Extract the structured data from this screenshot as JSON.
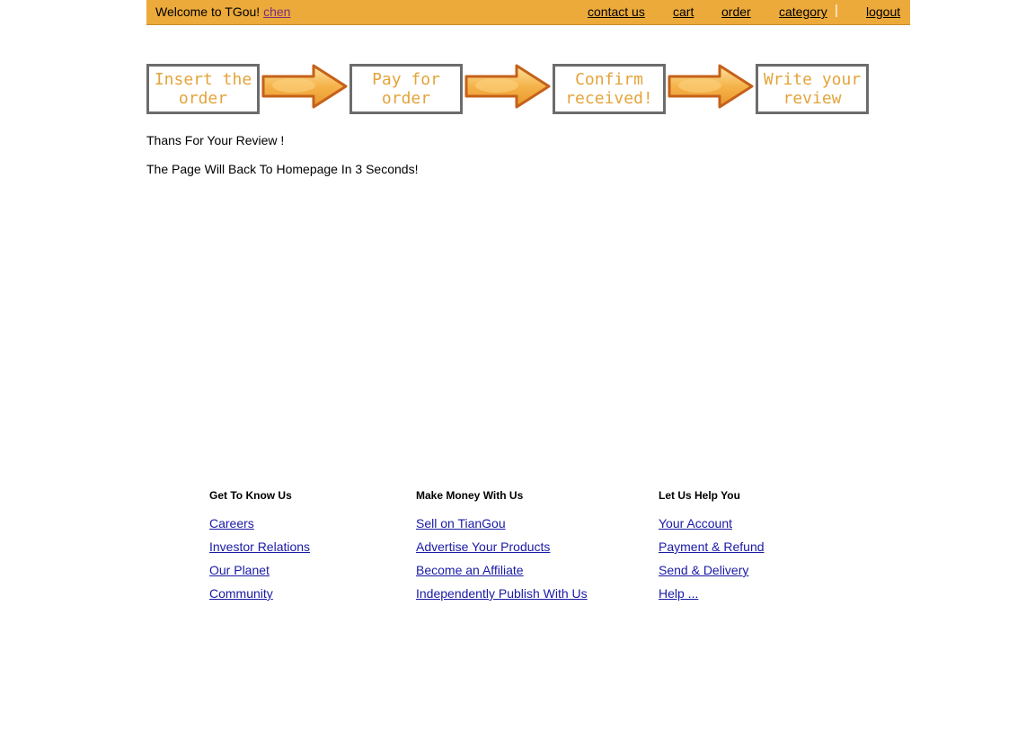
{
  "header": {
    "welcome_text": "Welcome to TGou!",
    "username": "chen",
    "nav": {
      "contact": "contact us",
      "cart": "cart",
      "order": "order",
      "category": "category",
      "separator": "|",
      "logout": "logout"
    },
    "bar_color": "#ecaa3b"
  },
  "steps": [
    {
      "label": "Insert the\norder"
    },
    {
      "label": "Pay for\norder"
    },
    {
      "label": "Confirm\nreceived!"
    },
    {
      "label": "Write your\nreview"
    }
  ],
  "arrow_icons": [
    "right-arrow-icon",
    "right-arrow-icon",
    "right-arrow-icon"
  ],
  "messages": {
    "thanks": "Thans For Your Review !",
    "redirect": "The Page Will Back To Homepage In 3 Seconds!"
  },
  "footer": {
    "columns": [
      {
        "heading": "Get To Know Us",
        "links": [
          "Careers",
          "Investor Relations",
          "Our Planet",
          "Community"
        ]
      },
      {
        "heading": "Make Money With Us",
        "links": [
          "Sell on TianGou",
          "Advertise Your Products",
          "Become an Affiliate",
          "Independently Publish With Us"
        ]
      },
      {
        "heading": "Let Us Help You",
        "links": [
          "Your Account",
          "Payment & Refund",
          "Send & Delivery",
          "Help ..."
        ]
      }
    ]
  },
  "colors": {
    "accent": "#ecaa3b",
    "step_text": "#e3a43c",
    "step_border": "#6c6c6c",
    "link": "#1a1aa6",
    "user_link": "#7a2e7e"
  }
}
